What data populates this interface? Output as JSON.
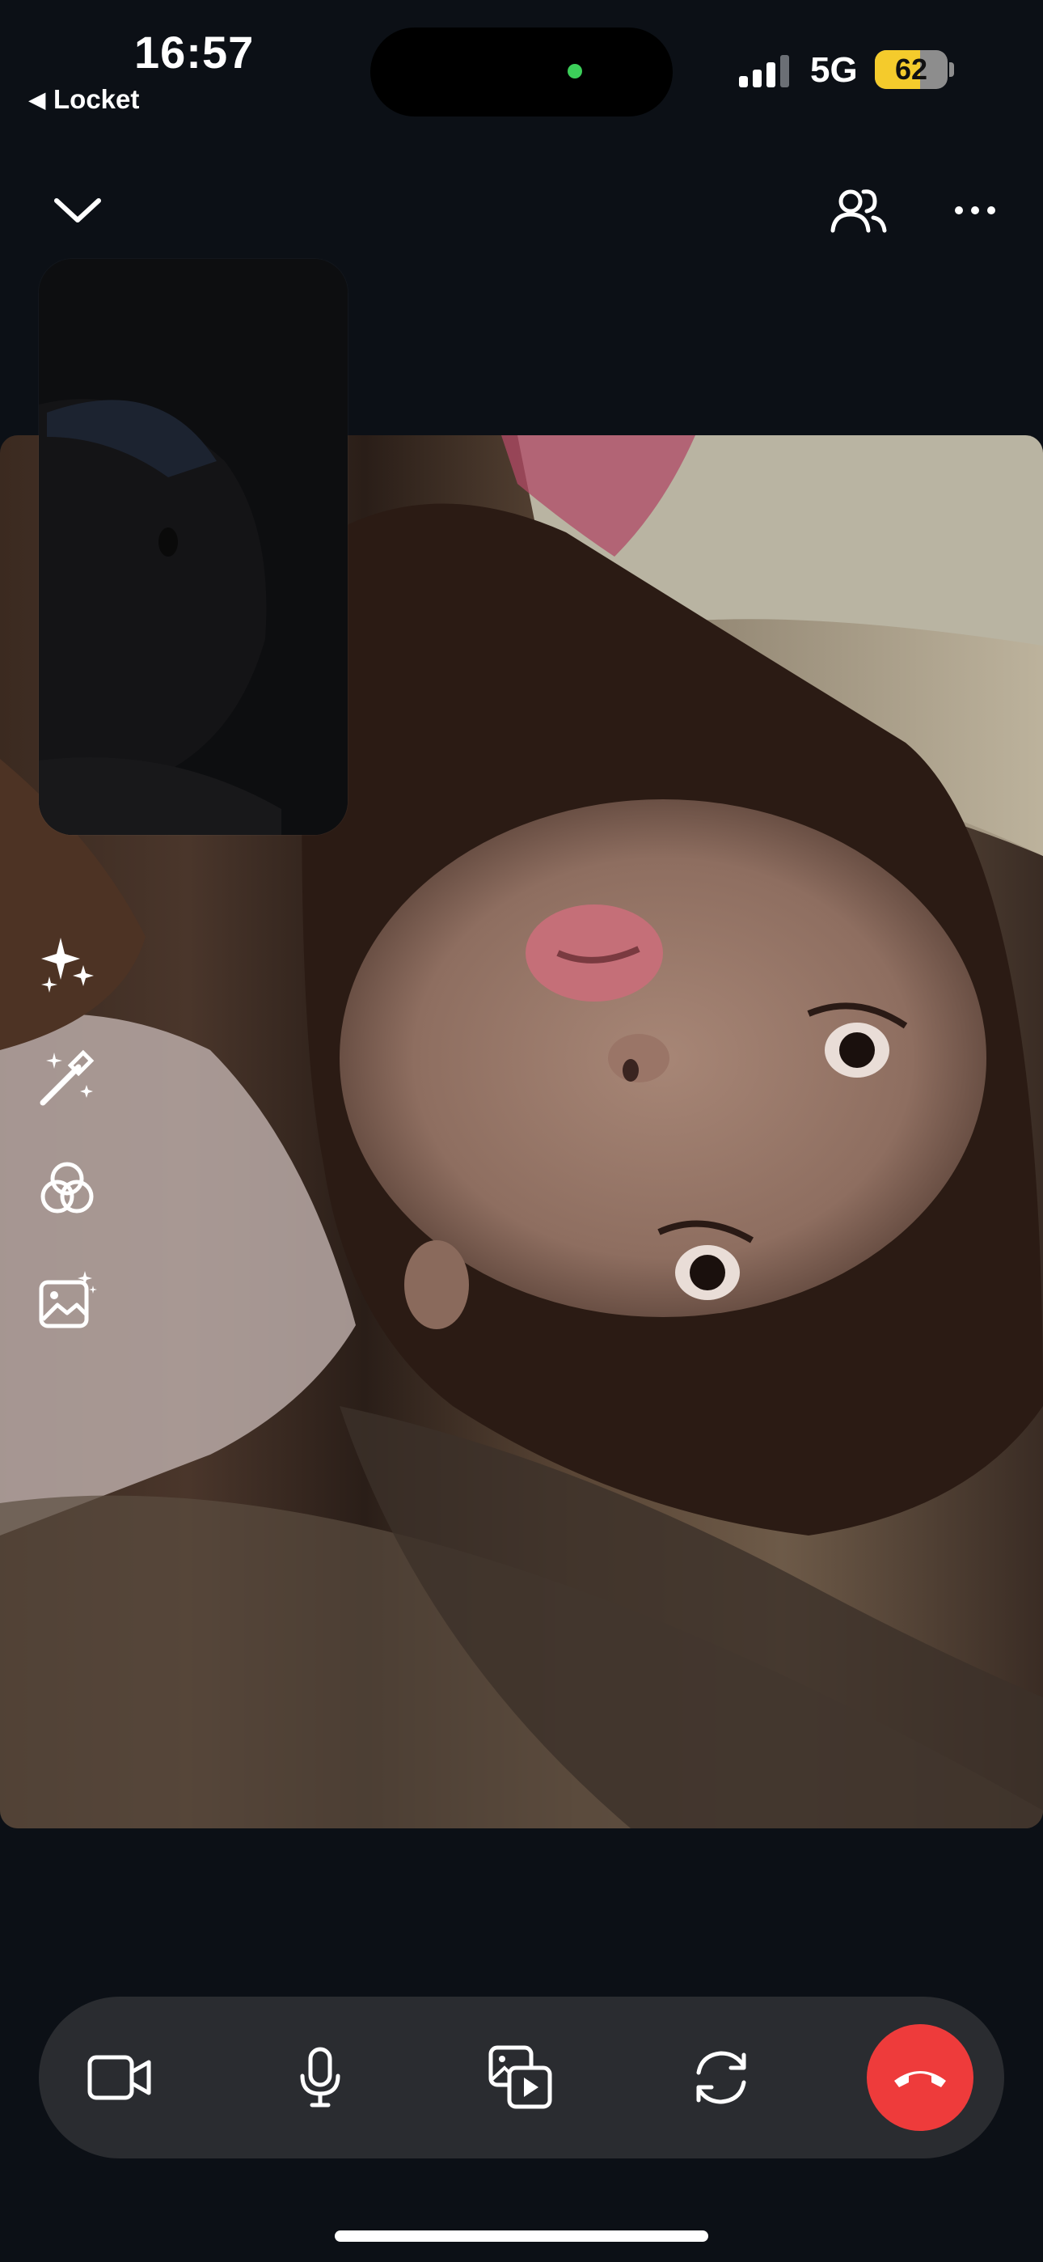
{
  "status_bar": {
    "time": "16:57",
    "back_app": "Locket",
    "network": "5G",
    "battery_level": "62",
    "battery_fraction": 0.62,
    "camera_indicator_color": "#3ccf5a"
  },
  "top_controls": {
    "minimize_icon": "chevron-down-icon",
    "participants_icon": "people-icon",
    "more_icon": "ellipsis-icon"
  },
  "side_tools": [
    "sparkles-icon",
    "magic-wand-icon",
    "color-filters-icon",
    "background-image-icon"
  ],
  "bottom_bar": {
    "buttons": [
      "video-camera-icon",
      "microphone-icon",
      "screen-share-icon",
      "flip-camera-icon",
      "end-call-icon"
    ],
    "end_call_color": "#ee3b3b"
  }
}
